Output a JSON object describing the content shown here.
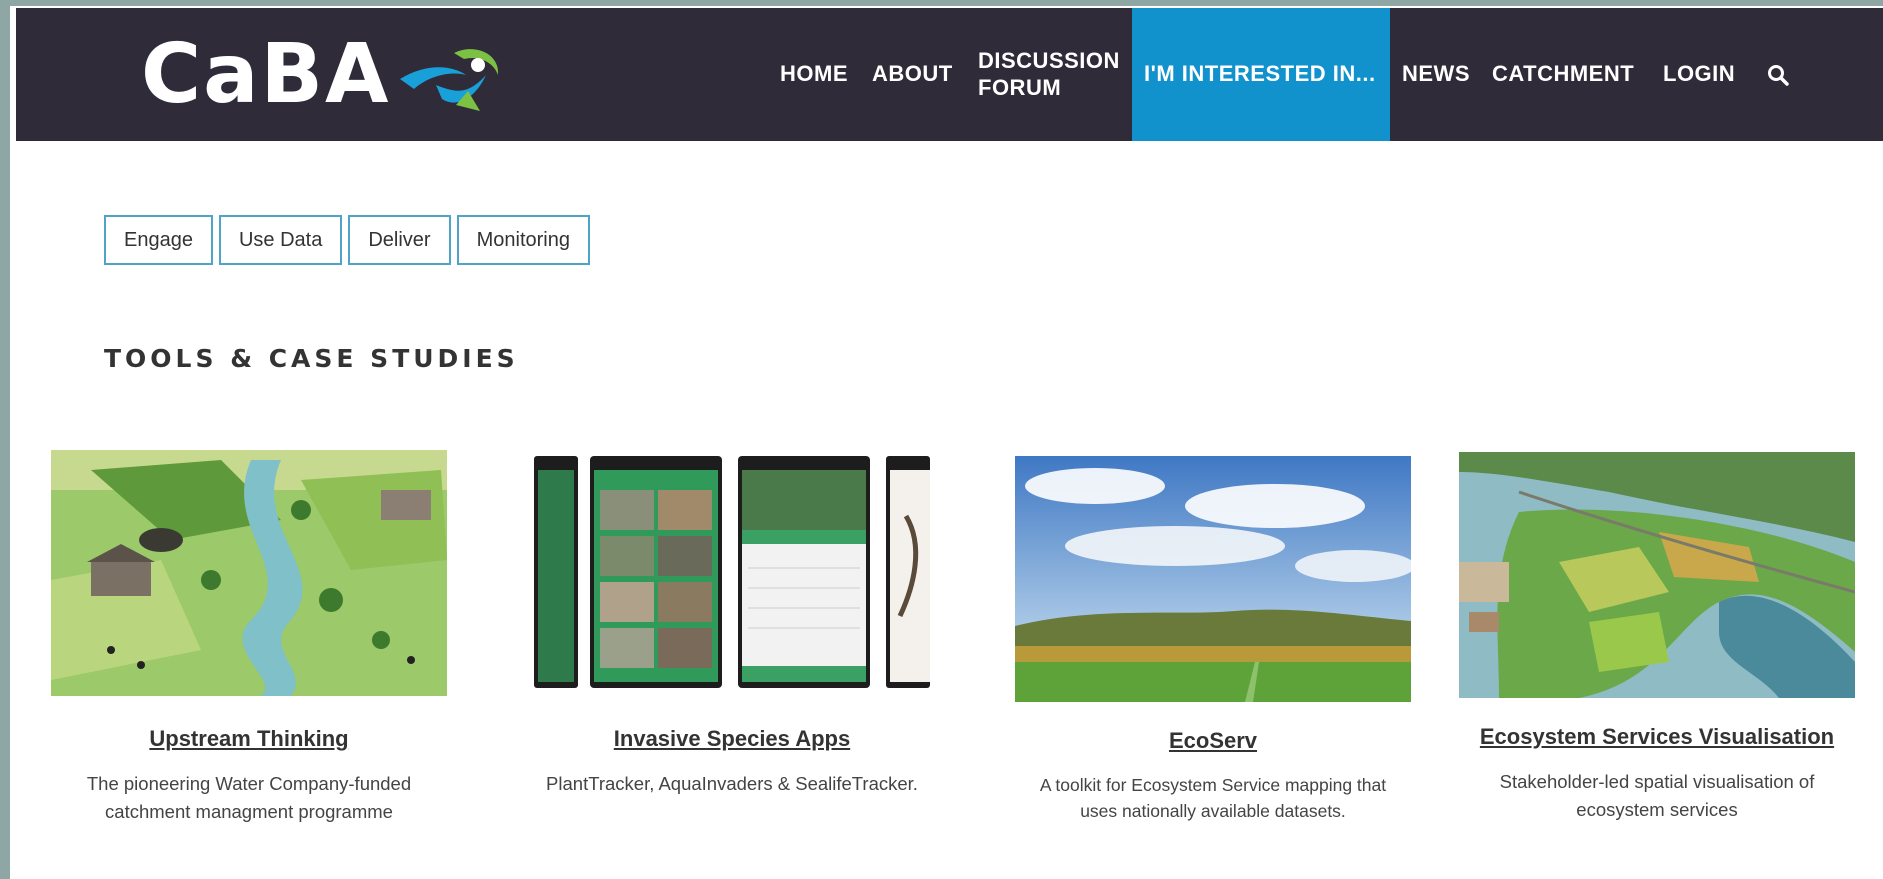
{
  "brand": {
    "logo_text": "CaBA"
  },
  "nav": {
    "home": "HOME",
    "about": "ABOUT",
    "discussion_line1": "DISCUSSION",
    "discussion_line2": "FORUM",
    "interested": "I'M INTERESTED IN...",
    "news": "NEWS",
    "catchment": "CATCHMENT",
    "login": "LOGIN"
  },
  "filters": [
    "Engage",
    "Use Data",
    "Deliver",
    "Monitoring"
  ],
  "section_title": "TOOLS & CASE STUDIES",
  "cards": [
    {
      "title": "Upstream Thinking",
      "desc_line1": "The pioneering Water Company-funded",
      "desc_line2": "catchment managment programme"
    },
    {
      "title": "Invasive Species Apps",
      "desc_line1": "PlantTracker, AquaInvaders & SealifeTracker.",
      "desc_line2": ""
    },
    {
      "title": "EcoServ",
      "desc_line1": "A toolkit for Ecosystem Service mapping that",
      "desc_line2": "uses nationally available datasets."
    },
    {
      "title": "Ecosystem Services Visualisation",
      "desc_line1": "Stakeholder-led spatial visualisation of",
      "desc_line2": "ecosystem services"
    }
  ],
  "colors": {
    "header_bg": "#2f2b38",
    "active_nav": "#1192cc",
    "filter_border": "#4fa3c4",
    "logo_blue": "#1aa0d8",
    "logo_green": "#7cc143"
  }
}
